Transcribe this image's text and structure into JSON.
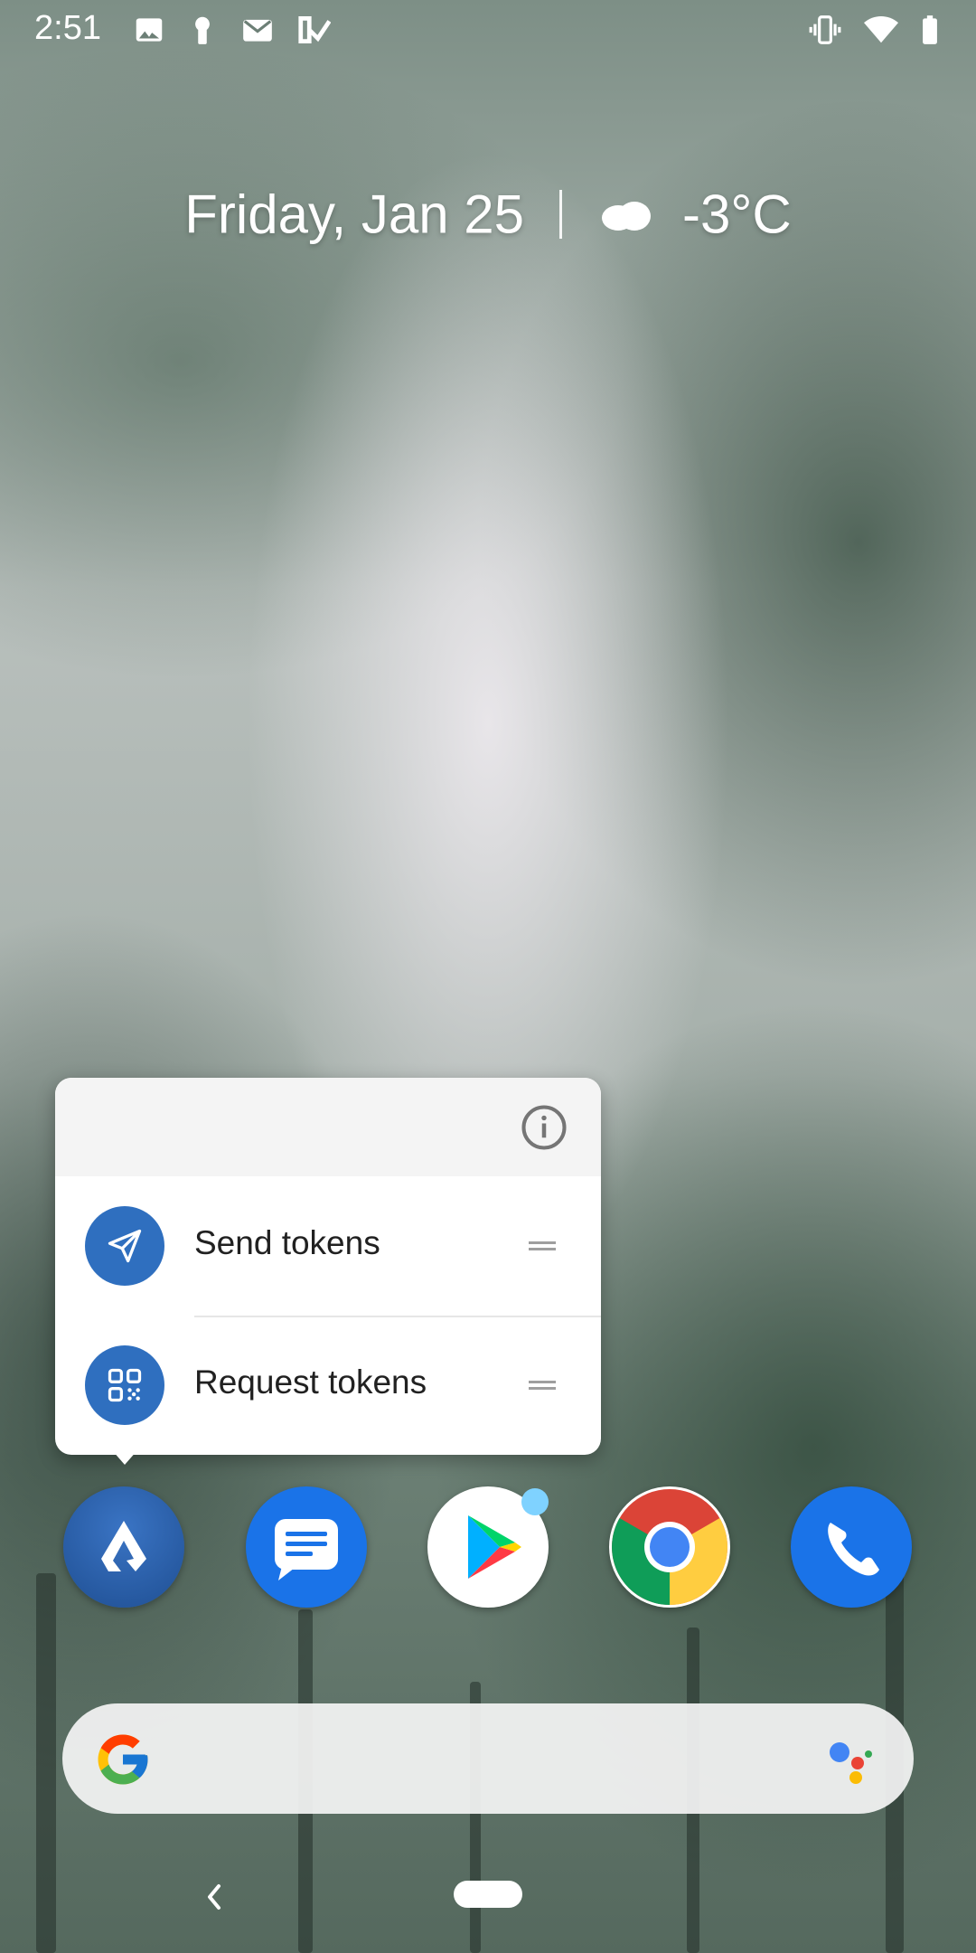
{
  "status_bar": {
    "time": "2:51",
    "left_icons": [
      "image-icon",
      "keyhole-icon",
      "gmail-icon",
      "task-check-icon"
    ],
    "right_icons": [
      "vibrate-icon",
      "wifi-icon",
      "battery-icon"
    ]
  },
  "at_a_glance": {
    "date": "Friday, Jan 25",
    "weather_icon": "cloud-icon",
    "temperature": "-3°C"
  },
  "shortcut_popup": {
    "info_icon": "info-icon",
    "items": [
      {
        "label": "Send tokens",
        "icon": "send-icon"
      },
      {
        "label": "Request tokens",
        "icon": "qr-code-icon"
      }
    ],
    "accent_color": "#2f6fbf"
  },
  "dock": {
    "apps": [
      {
        "name": "lisk-app-icon",
        "color": "#2b5fa8"
      },
      {
        "name": "messages-app-icon",
        "color": "#1a73e8"
      },
      {
        "name": "play-store-app-icon",
        "color": "#ffffff",
        "has_notification_dot": true
      },
      {
        "name": "chrome-app-icon",
        "color": "#ffffff"
      },
      {
        "name": "phone-app-icon",
        "color": "#1a73e8"
      }
    ]
  },
  "search_bar": {
    "left_icon": "google-g-icon",
    "right_icon": "assistant-icon"
  },
  "navigation": {
    "back_icon": "back-icon",
    "home_icon": "home-pill-icon"
  }
}
